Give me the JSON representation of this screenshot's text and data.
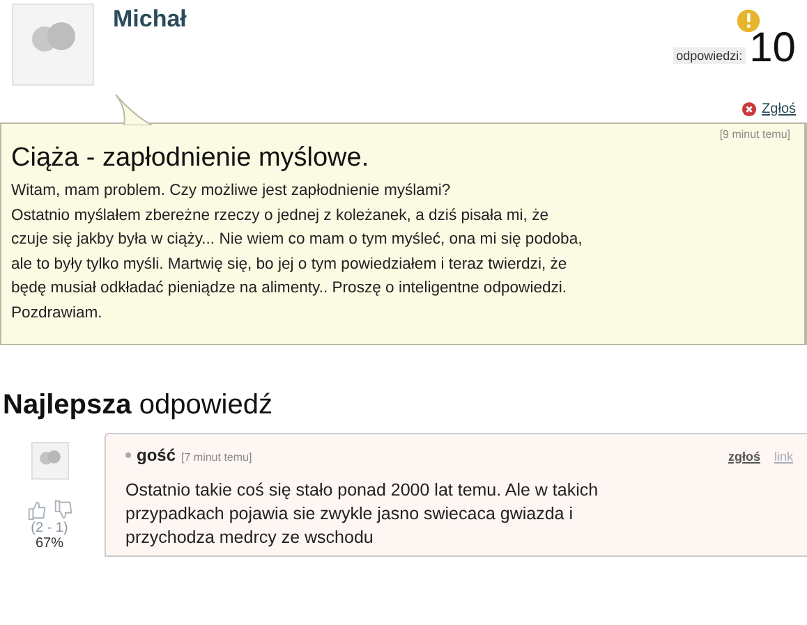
{
  "question": {
    "author": "Michał",
    "answers_label": "odpowiedzi:",
    "answers_count": "10",
    "report": "Zgłoś",
    "time": "[9 minut temu]",
    "title": "Ciąża - zapłodnienie myślowe.",
    "body": "Witam, mam problem. Czy możliwe jest zapłodnienie myślami?\nOstatnio myślałem zbereżne rzeczy o jednej z koleżanek, a dziś pisała mi, że\nczuje się jakby była w ciąży... Nie wiem co mam o tym myśleć, ona mi się podoba,\nale to były tylko myśli. Martwię się, bo jej o tym powiedziałem i teraz twierdzi, że\nbędę musiał odkładać pieniądze na alimenty.. Proszę o inteligentne odpowiedzi.\nPozdrawiam."
  },
  "best_answer": {
    "heading": "**Najlepsza** odpowiedź",
    "votes": "(2 - 1)",
    "percent": "67%",
    "author": "gość",
    "time": "[7 minut temu]",
    "report": "zgłoś",
    "link": "link",
    "body": "Ostatnio takie coś się stało ponad 2000 lat temu. Ale w takich\nprzypadkach pojawia sie zwykle jasno swiecaca gwiazda i\nprzychodza medrcy ze wschodu"
  }
}
